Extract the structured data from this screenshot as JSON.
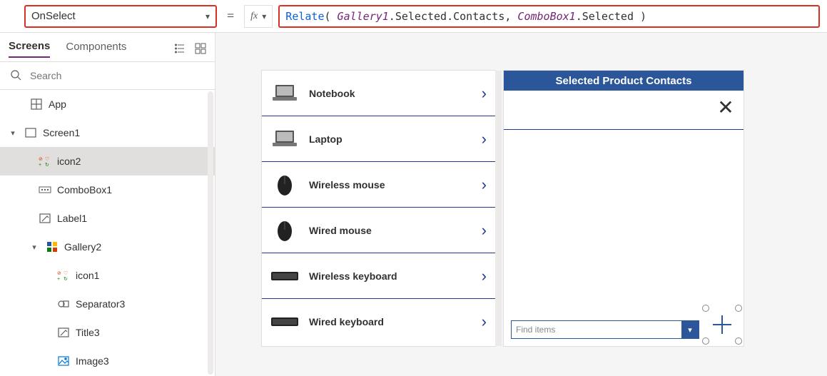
{
  "formula_bar": {
    "property": "OnSelect",
    "equals": "=",
    "fx_label": "fx",
    "formula_tokens": [
      {
        "t": "fn",
        "v": "Relate"
      },
      {
        "t": "plain",
        "v": "( "
      },
      {
        "t": "var",
        "v": "Gallery1"
      },
      {
        "t": "plain",
        "v": ".Selected.Contacts, "
      },
      {
        "t": "var",
        "v": "ComboBox1"
      },
      {
        "t": "plain",
        "v": ".Selected )"
      }
    ]
  },
  "tree": {
    "tabs": {
      "screens": "Screens",
      "components": "Components"
    },
    "search_placeholder": "Search",
    "nodes": {
      "app": "App",
      "screen1": "Screen1",
      "icon2": "icon2",
      "combobox1": "ComboBox1",
      "label1": "Label1",
      "gallery2": "Gallery2",
      "icon1": "icon1",
      "separator3": "Separator3",
      "title3": "Title3",
      "image3": "Image3"
    }
  },
  "gallery": {
    "items": [
      {
        "label": "Notebook",
        "thumb": "laptop"
      },
      {
        "label": "Laptop",
        "thumb": "laptop"
      },
      {
        "label": "Wireless mouse",
        "thumb": "mouse"
      },
      {
        "label": "Wired mouse",
        "thumb": "mouse"
      },
      {
        "label": "Wireless keyboard",
        "thumb": "keyboard"
      },
      {
        "label": "Wired keyboard",
        "thumb": "keyboard"
      }
    ]
  },
  "right_card": {
    "title": "Selected Product Contacts",
    "combo_placeholder": "Find items"
  }
}
